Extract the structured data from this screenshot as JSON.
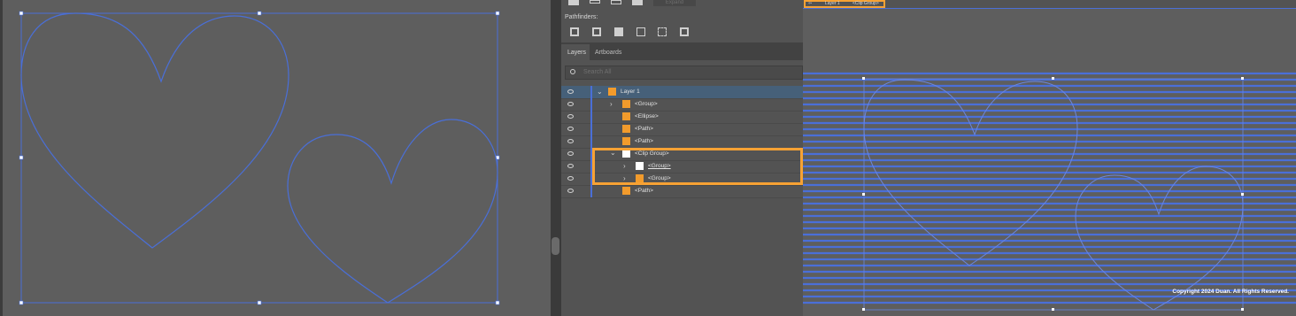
{
  "panel": {
    "top_button": "Expand",
    "pathfinders_label": "Pathfinders:",
    "tabs": [
      {
        "label": "Layers"
      },
      {
        "label": "Artboards"
      }
    ],
    "search_placeholder": "Search All"
  },
  "layers": [
    {
      "label": "Layer 1"
    },
    {
      "label": "<Group>"
    },
    {
      "label": "<Ellipse>"
    },
    {
      "label": "<Path>"
    },
    {
      "label": "<Path>"
    },
    {
      "label": "<Clip Group>"
    },
    {
      "label": "<Group>"
    },
    {
      "label": "<Group>"
    },
    {
      "label": "<Path>"
    }
  ],
  "breadcrumb": {
    "layer": "Layer 1",
    "clip": "<Clip Group>"
  },
  "copyright": "Copyright 2024 Duan. All Rights Reserved.",
  "colors": {
    "accent": "#f29b2c",
    "selection": "#4a6fd8",
    "highlight": "#f7a234"
  }
}
